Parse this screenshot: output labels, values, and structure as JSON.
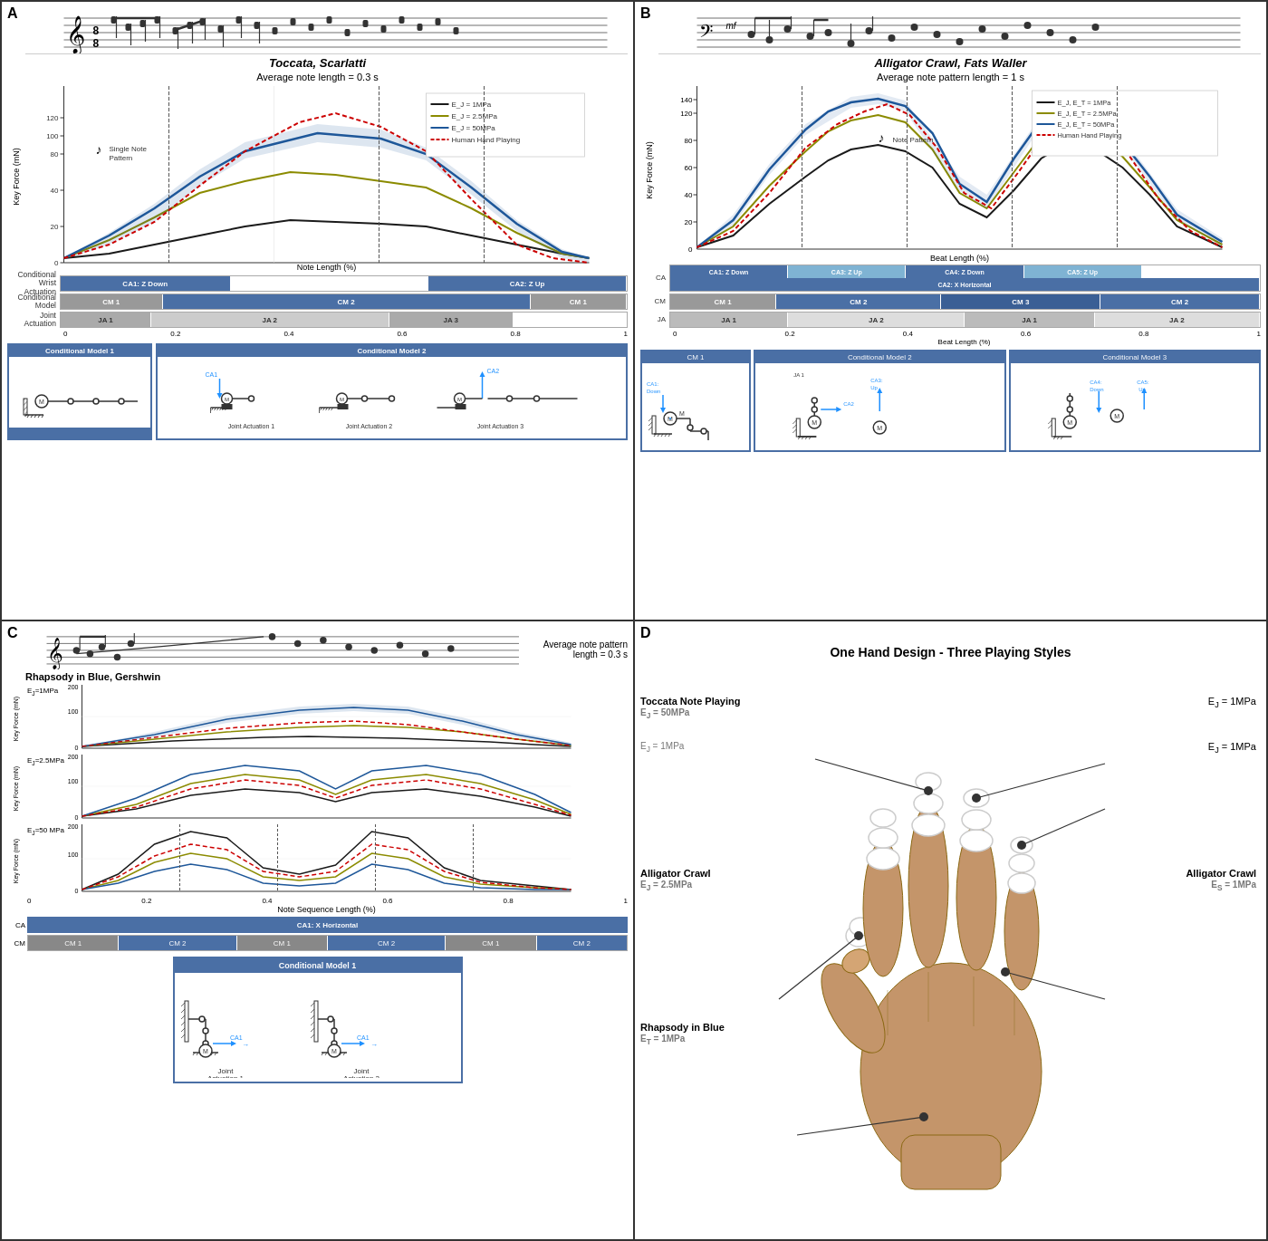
{
  "panels": {
    "A": {
      "label": "A",
      "title": "Toccata,",
      "title_composer": "Scarlatti",
      "subtitle": "Average note length = 0.3 s",
      "yaxis": "Key Force (mN)",
      "xaxis": "Note Length (%)",
      "note_type": "Single Note Pattern",
      "legend": [
        {
          "color": "#1a1a1a",
          "label": "EJ = 1MPa"
        },
        {
          "color": "#8B8B00",
          "label": "EJ = 2.5MPa"
        },
        {
          "color": "#1E5799",
          "label": "EJ = 50MPa"
        },
        {
          "color": "#cc0000",
          "label": "Human Hand Playing",
          "dash": true
        }
      ],
      "ca_rows": [
        {
          "label": "Conditional\nWrist\nActuation",
          "boxes": [
            {
              "text": "CA1: Z Down",
              "color": "blue",
              "width": 35
            },
            {
              "text": "",
              "color": "empty",
              "width": 30
            },
            {
              "text": "CA2: Z Up",
              "color": "blue",
              "width": 35
            }
          ]
        },
        {
          "label": "Conditional\nModel",
          "boxes": [
            {
              "text": "CM 1",
              "color": "gray",
              "width": 20
            },
            {
              "text": "CM 2",
              "color": "blue",
              "width": 60
            },
            {
              "text": "CM 1",
              "color": "gray",
              "width": 20
            }
          ]
        },
        {
          "label": "Joint\nActuation",
          "boxes": [
            {
              "text": "JA 1",
              "color": "dark-gray",
              "width": 18
            },
            {
              "text": "JA 2",
              "color": "gray",
              "width": 44
            },
            {
              "text": "JA 3",
              "color": "dark-gray",
              "width": 20
            },
            {
              "text": "",
              "color": "empty",
              "width": 18
            }
          ]
        }
      ],
      "diagrams": [
        {
          "title": "Conditional Model 1",
          "label": "CM1"
        },
        {
          "title": "Conditional Model 2",
          "label": "CM2"
        }
      ]
    },
    "B": {
      "label": "B",
      "title": "Alligator Crawl,",
      "title_composer": "Fats Waller",
      "subtitle": "Average note pattern length = 1 s",
      "yaxis": "Key Force (mN)",
      "xaxis": "Beat Length (%)",
      "note_type": "Note Pattern",
      "legend": [
        {
          "color": "#1a1a1a",
          "label": "EJ, ET = 1MPa"
        },
        {
          "color": "#8B8B00",
          "label": "EJ, ET = 2.5MPa"
        },
        {
          "color": "#1E5799",
          "label": "EJ, ET = 50MPa"
        },
        {
          "color": "#cc0000",
          "label": "Human Hand Playing",
          "dash": true
        }
      ],
      "ca_rows": [
        {
          "label": "CA",
          "boxes": [
            {
              "text": "CA1: Z Down",
              "color": "blue",
              "width": 18
            },
            {
              "text": "CA3: Z Up",
              "color": "light-blue",
              "width": 18
            },
            {
              "text": "CA4: Z Down",
              "color": "blue",
              "width": 18
            },
            {
              "text": "CA5: Z Up",
              "color": "light-blue",
              "width": 18
            },
            {
              "text": "CA2: X Horizontal",
              "color": "blue",
              "width": 28
            }
          ]
        },
        {
          "label": "CM",
          "boxes": [
            {
              "text": "CM 1",
              "color": "gray",
              "width": 20
            },
            {
              "text": "CM 2",
              "color": "blue",
              "width": 30
            },
            {
              "text": "CM 3",
              "color": "blue",
              "width": 25
            },
            {
              "text": "CM 2",
              "color": "blue",
              "width": 25
            }
          ]
        },
        {
          "label": "JA",
          "boxes": [
            {
              "text": "JA 1",
              "color": "dark-gray",
              "width": 22
            },
            {
              "text": "JA 2",
              "color": "gray",
              "width": 30
            },
            {
              "text": "JA 1",
              "color": "dark-gray",
              "width": 22
            },
            {
              "text": "JA 2",
              "color": "gray",
              "width": 26
            }
          ]
        }
      ],
      "diagrams": [
        {
          "title": "CM 1",
          "label": "CM1"
        },
        {
          "title": "Conditional Model 2",
          "label": "CM2"
        },
        {
          "title": "Conditional Model 3",
          "label": "CM3"
        }
      ]
    },
    "C": {
      "label": "C",
      "title": "Rhapsody in Blue, Gershwin",
      "subtitle": "Average note pattern length = 0.3 s",
      "charts": [
        {
          "label": "EJ=1MPa",
          "ymax": 200
        },
        {
          "label": "EJ=2.5MPa",
          "ymax": 200
        },
        {
          "label": "EJ=50 MPa",
          "ymax": 200
        }
      ],
      "ca_row": {
        "text": "CA1: X Horizontal",
        "color": "blue"
      },
      "cm_boxes": [
        {
          "text": "CM 1",
          "width": 15
        },
        {
          "text": "CM 2",
          "width": 20
        },
        {
          "text": "CM 1",
          "width": 15
        },
        {
          "text": "CM 2",
          "width": 20
        },
        {
          "text": "CM 1",
          "width": 15
        },
        {
          "text": "CM 2",
          "width": 15
        }
      ]
    },
    "D": {
      "label": "D",
      "title": "One Hand Design - Three Playing Styles",
      "annotations": [
        {
          "text": "Toccata Note Playing",
          "subtext": "EJ = 50MPa",
          "position": "top-left"
        },
        {
          "text": "EJ = 1MPa",
          "position": "top-right-1"
        },
        {
          "text": "EJ = 1MPa",
          "position": "top-right-2"
        },
        {
          "text": "Alligator Crawl",
          "subtext": "EJ = 2.5MPa",
          "position": "mid-left"
        },
        {
          "text": "Alligator Crawl",
          "subtext": "ES = 1MPa",
          "position": "mid-right"
        },
        {
          "text": "Rhapsody in Blue",
          "subtext": "ET = 1MPa",
          "position": "bot-left"
        }
      ]
    }
  }
}
